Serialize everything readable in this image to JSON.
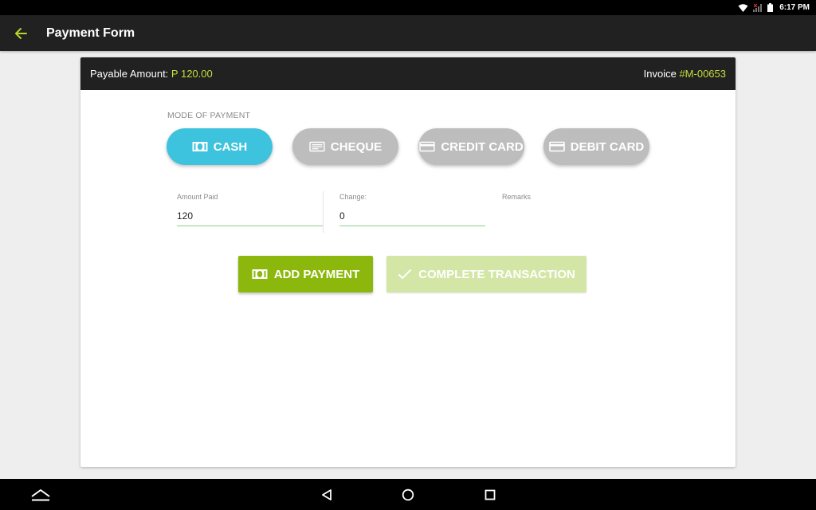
{
  "status_bar": {
    "time": "6:17 PM"
  },
  "app_bar": {
    "title": "Payment Form"
  },
  "card_header": {
    "payable_label": "Payable Amount:",
    "payable_value": "P 120.00",
    "invoice_label": "Invoice",
    "invoice_value": "#M-00653"
  },
  "payment": {
    "mode_label": "MODE OF PAYMENT",
    "modes": [
      {
        "label": "CASH",
        "icon": "cash-icon",
        "selected": true
      },
      {
        "label": "CHEQUE",
        "icon": "cheque-icon",
        "selected": false
      },
      {
        "label": "CREDIT CARD",
        "icon": "credit-card-icon",
        "selected": false
      },
      {
        "label": "DEBIT CARD",
        "icon": "debit-card-icon",
        "selected": false
      }
    ]
  },
  "fields": {
    "amount_paid": {
      "label": "Amount Paid",
      "value": "120"
    },
    "change": {
      "label": "Change:",
      "value": "0"
    },
    "remarks": {
      "label": "Remarks",
      "value": ""
    }
  },
  "actions": {
    "add_payment": "ADD PAYMENT",
    "complete_transaction": "COMPLETE TRANSACTION"
  },
  "colors": {
    "accent_green": "#8cb80e",
    "selected_blue": "#3dc3dd",
    "highlight_text": "#c6dd3b"
  }
}
